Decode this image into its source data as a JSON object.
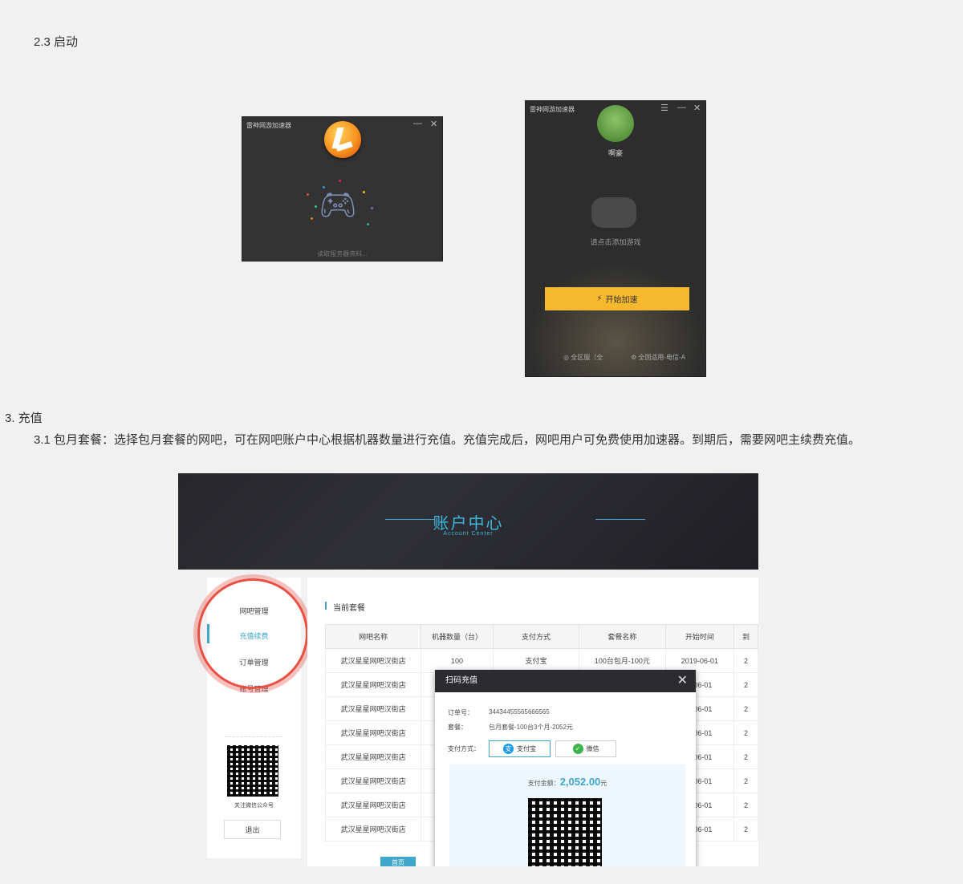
{
  "doc": {
    "section_23": "2.3 启动",
    "section_3": "3. 充值",
    "para_31": "3.1 包月套餐：选择包月套餐的网吧，可在网吧账户中心根据机器数量进行充值。充值完成后，网吧用户可免费使用加速器。到期后，需要网吧主续费充值。"
  },
  "launcher1": {
    "title": "雷神网游加速器",
    "minimize": "—",
    "close": "✕",
    "loading_text": "读取服务器资料..."
  },
  "launcher2": {
    "title": "雷神网游加速器",
    "menu": "☰",
    "minimize": "—",
    "close": "✕",
    "username": "啊豪",
    "hint": "请点击添加游戏",
    "start_button": "开始加速",
    "bolt": "⚡",
    "server_left": "◎ 全区服（全",
    "server_right": "⚙ 全国适用-电信-A"
  },
  "account": {
    "title": "账户中心",
    "subtitle": "Account Center",
    "sidebar": [
      "网吧管理",
      "充值续费",
      "订单管理",
      "账号管理"
    ],
    "qr_caption": "关注微信公众号",
    "logout": "退出",
    "section_title": "当前套餐",
    "columns": [
      "网吧名称",
      "机器数量（台）",
      "支付方式",
      "套餐名称",
      "开始时间",
      "到"
    ],
    "rows": [
      [
        "武汉星星网吧汉街店",
        "100",
        "支付宝",
        "100台包月-100元",
        "2019-06-01",
        "2"
      ],
      [
        "武汉星星网吧汉街店",
        "",
        "",
        "",
        "9-06-01",
        "2"
      ],
      [
        "武汉星星网吧汉街店",
        "",
        "",
        "",
        "9-06-01",
        "2"
      ],
      [
        "武汉星星网吧汉街店",
        "",
        "",
        "",
        "9-06-01",
        "2"
      ],
      [
        "武汉星星网吧汉街店",
        "",
        "",
        "",
        "9-06-01",
        "2"
      ],
      [
        "武汉星星网吧汉街店",
        "",
        "",
        "",
        "9-06-01",
        "2"
      ],
      [
        "武汉星星网吧汉街店",
        "",
        "",
        "",
        "9-06-01",
        "2"
      ],
      [
        "武汉星星网吧汉街店",
        "",
        "",
        "",
        "9-06-01",
        "2"
      ]
    ],
    "page_first": "首页"
  },
  "modal": {
    "title": "扫码充值",
    "close": "✕",
    "order_label": "订单号：",
    "order_value": "34434455565666565",
    "package_label": "套餐：",
    "package_value": "包月套餐-100台3个月-2052元",
    "pay_label": "支付方式：",
    "alipay": "支付宝",
    "wechat": "微信",
    "alipay_icon": "支",
    "wechat_icon": "✓",
    "amount_label": "支付金额：",
    "amount_value": "2,052.00",
    "amount_unit": "元"
  },
  "colors": {
    "accent": "#3fa6cc",
    "button": "#f5b82e",
    "highlight_ring": "#e94f43"
  }
}
